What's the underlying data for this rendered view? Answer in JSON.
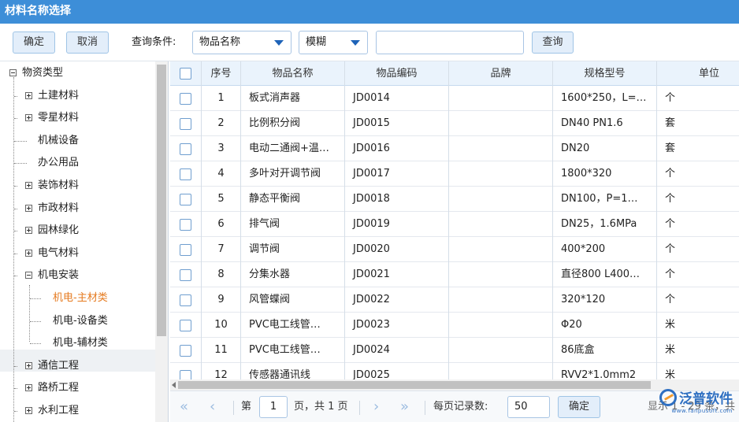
{
  "window": {
    "title": "材料名称选择"
  },
  "toolbar": {
    "confirm_label": "确定",
    "cancel_label": "取消",
    "query_condition_label": "查询条件:",
    "field_select_value": "物品名称",
    "match_select_value": "模糊",
    "search_value": "",
    "query_label": "查询"
  },
  "tree": {
    "root": "物资类型",
    "items": [
      {
        "label": "土建材料",
        "expander": "plus"
      },
      {
        "label": "零星材料",
        "expander": "plus"
      },
      {
        "label": "机械设备",
        "expander": "none"
      },
      {
        "label": "办公用品",
        "expander": "none"
      },
      {
        "label": "装饰材料",
        "expander": "plus"
      },
      {
        "label": "市政材料",
        "expander": "plus"
      },
      {
        "label": "园林绿化",
        "expander": "plus"
      },
      {
        "label": "电气材料",
        "expander": "plus"
      },
      {
        "label": "机电安装",
        "expander": "minus"
      },
      {
        "label": "机电-主材类",
        "expander": "none",
        "selected": true
      },
      {
        "label": "机电-设备类",
        "expander": "none"
      },
      {
        "label": "机电-辅材类",
        "expander": "none"
      },
      {
        "label": "通信工程",
        "expander": "plus"
      },
      {
        "label": "路桥工程",
        "expander": "plus"
      },
      {
        "label": "水利工程",
        "expander": "plus"
      }
    ]
  },
  "grid": {
    "columns": [
      "序号",
      "物品名称",
      "物品编码",
      "品牌",
      "规格型号",
      "单位"
    ],
    "rows": [
      [
        "1",
        "板式消声器",
        "JD0014",
        "",
        "1600*250，L=…",
        "个"
      ],
      [
        "2",
        "比例积分阀",
        "JD0015",
        "",
        "DN40 PN1.6",
        "套"
      ],
      [
        "3",
        "电动二通阀+温…",
        "JD0016",
        "",
        "DN20",
        "套"
      ],
      [
        "4",
        "多叶对开调节阀",
        "JD0017",
        "",
        "1800*320",
        "个"
      ],
      [
        "5",
        "静态平衡阀",
        "JD0018",
        "",
        "DN100，P=1…",
        "个"
      ],
      [
        "6",
        "排气阀",
        "JD0019",
        "",
        "DN25，1.6MPa",
        "个"
      ],
      [
        "7",
        "调节阀",
        "JD0020",
        "",
        "400*200",
        "个"
      ],
      [
        "8",
        "分集水器",
        "JD0021",
        "",
        "直径800 L400…",
        "个"
      ],
      [
        "9",
        "风管蝶阀",
        "JD0022",
        "",
        "320*120",
        "个"
      ],
      [
        "10",
        "PVC电工线管…",
        "JD0023",
        "",
        "Φ20",
        "米"
      ],
      [
        "11",
        "PVC电工线管…",
        "JD0024",
        "",
        "86底盒",
        "米"
      ],
      [
        "12",
        "传感器通讯线",
        "JD0025",
        "",
        "RVV2*1.0mm2",
        "米"
      ]
    ]
  },
  "pager": {
    "page_prefix": "第",
    "page_value": "1",
    "page_suffix": "页，共 1 页",
    "page_size_label": "每页记录数:",
    "page_size_value": "50",
    "confirm_label": "确定",
    "summary": "显示 1 - 29 条，共"
  },
  "brand": {
    "name": "泛普软件",
    "url": "www.fanpusoft.com"
  },
  "colors": {
    "titlebar": "#3d8ed8",
    "selected_text": "#e57a1f",
    "link_blue": "#1e63b8"
  }
}
